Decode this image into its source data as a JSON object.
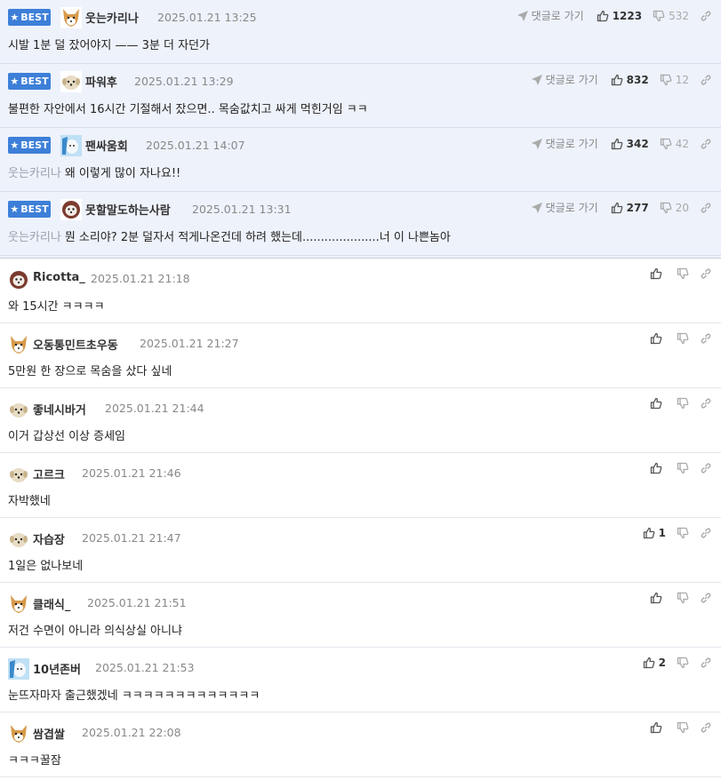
{
  "best_badge_label": "BEST",
  "reply_link_label": "댓글로 가기",
  "best_comments": [
    {
      "nick": "웃는카리나",
      "date": "2025.01.21 13:25",
      "mention": "",
      "text": "시발 1분 덜 잤어야지 —— 3분 더 자던가",
      "likes": "1223",
      "dislikes": "532",
      "avatar": "shiba"
    },
    {
      "nick": "파워후",
      "date": "2025.01.21 13:29",
      "mention": "",
      "text": "불편한 자안에서 16시간 기절해서 잤으면.. 목숨값치고 싸게 먹힌거임 ㅋㅋ",
      "likes": "832",
      "dislikes": "12",
      "avatar": "puppy"
    },
    {
      "nick": "팬싸움회",
      "date": "2025.01.21 14:07",
      "mention": "웃는카리나",
      "text": "왜 이렇게 많이 자나요!!",
      "likes": "342",
      "dislikes": "42",
      "avatar": "blue"
    },
    {
      "nick": "못할말도하는사람",
      "date": "2025.01.21 13:31",
      "mention": "웃는카리나",
      "text": "뭔 소리야? 2분 덜자서 적게나온건데 하려 했는데.....................너 이 나쁜놈아",
      "likes": "277",
      "dislikes": "20",
      "avatar": "red"
    }
  ],
  "comments": [
    {
      "nick": "Ricotta_",
      "date": "2025.01.21 21:18",
      "text": "와 15시간 ㅋㅋㅋㅋ",
      "likes": "",
      "avatar": "red"
    },
    {
      "nick": "오동통민트초우동",
      "date": "2025.01.21 21:27",
      "text": "5만원 한 장으로 목숨을 샀다 싶네",
      "likes": "",
      "avatar": "shiba"
    },
    {
      "nick": "좋네시바거",
      "date": "2025.01.21 21:44",
      "text": "이거 갑상선 이상 증세임",
      "likes": "",
      "avatar": "puppy"
    },
    {
      "nick": "고르크",
      "date": "2025.01.21 21:46",
      "text": "자박했네",
      "likes": "",
      "avatar": "puppy"
    },
    {
      "nick": "자습장",
      "date": "2025.01.21 21:47",
      "text": "1일은 없나보네",
      "likes": "1",
      "avatar": "puppy"
    },
    {
      "nick": "클래식_",
      "date": "2025.01.21 21:51",
      "text": "저건 수면이 아니라 의식상실 아니냐",
      "likes": "",
      "avatar": "shiba"
    },
    {
      "nick": "10년존버",
      "date": "2025.01.21 21:53",
      "text": "눈뜨자마자 출근했겠네 ㅋㅋㅋㅋㅋㅋㅋㅋㅋㅋㅋㅋㅋ",
      "likes": "2",
      "avatar": "blue"
    },
    {
      "nick": "쌈겹쌀",
      "date": "2025.01.21 22:08",
      "text": "ㅋㅋㅋ꿀잠",
      "likes": "",
      "avatar": "shiba"
    }
  ],
  "colors": {
    "best_bg": "#eef2fb",
    "badge": "#3d7fd8",
    "divider": "#e3e6ec"
  }
}
